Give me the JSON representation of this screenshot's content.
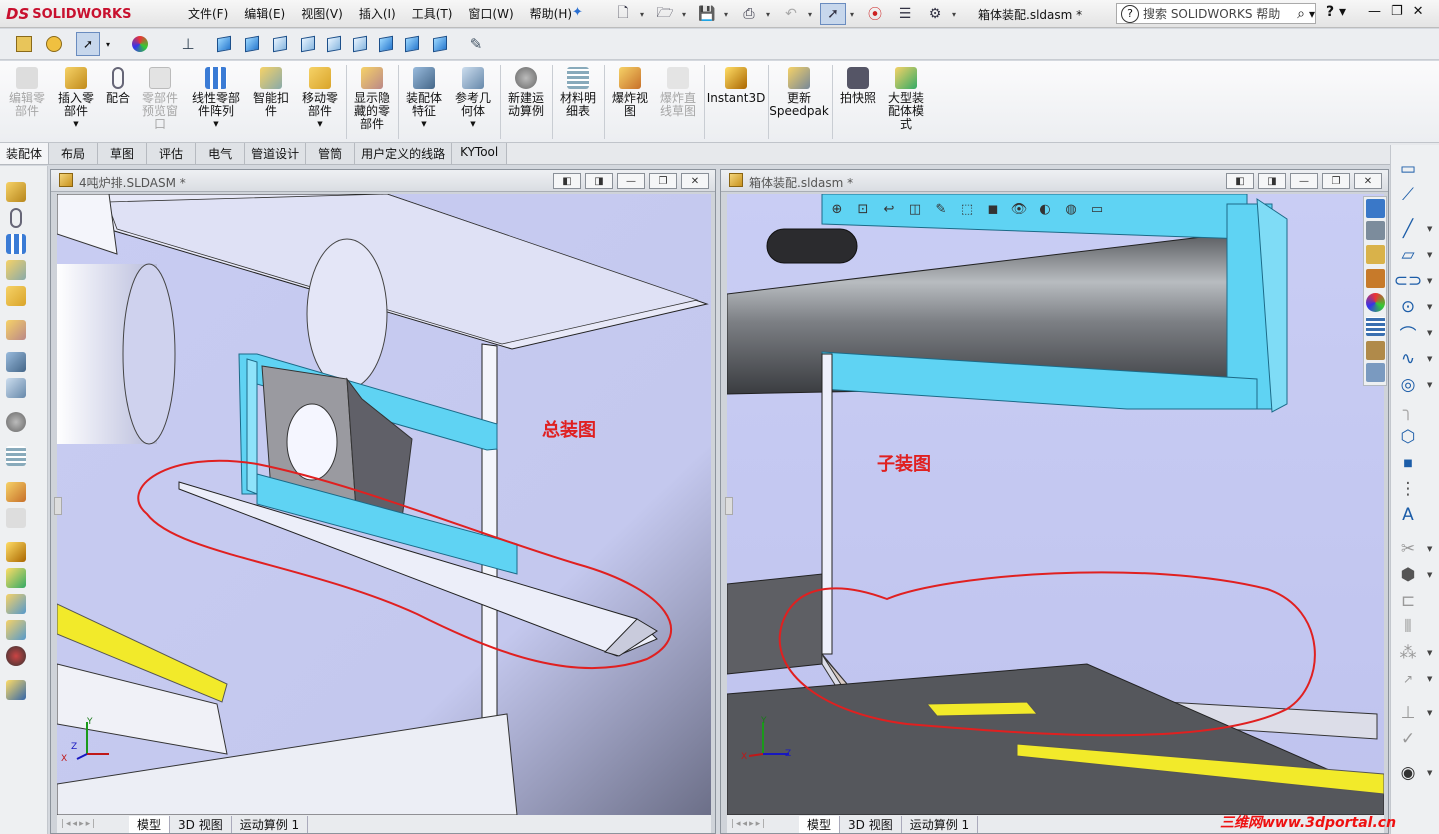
{
  "app": {
    "logo_prefix": "DS",
    "logo_name": "SOLIDWORKS"
  },
  "menu": [
    "文件(F)",
    "编辑(E)",
    "视图(V)",
    "插入(I)",
    "工具(T)",
    "窗口(W)",
    "帮助(H)"
  ],
  "document_title": "箱体装配.sldasm *",
  "search": {
    "placeholder": "搜索 SOLIDWORKS 帮助"
  },
  "command_manager": {
    "items": [
      {
        "label": "编辑零\n部件",
        "enabled": false
      },
      {
        "label": "插入零\n部件",
        "enabled": true
      },
      {
        "label": "配合",
        "enabled": true
      },
      {
        "label": "零部件\n预览窗\n口",
        "enabled": false
      },
      {
        "label": "线性零部\n件阵列",
        "enabled": true
      },
      {
        "label": "智能扣\n件",
        "enabled": true
      },
      {
        "label": "移动零\n部件",
        "enabled": true
      },
      {
        "label": "显示隐\n藏的零\n部件",
        "enabled": true
      },
      {
        "label": "装配体\n特征",
        "enabled": true
      },
      {
        "label": "参考几\n何体",
        "enabled": true
      },
      {
        "label": "新建运\n动算例",
        "enabled": true
      },
      {
        "label": "材料明\n细表",
        "enabled": true
      },
      {
        "label": "爆炸视\n图",
        "enabled": true
      },
      {
        "label": "爆炸直\n线草图",
        "enabled": false
      },
      {
        "label": "Instant3D",
        "enabled": true
      },
      {
        "label": "更新\nSpeedpak",
        "enabled": true
      },
      {
        "label": "拍快照",
        "enabled": true
      },
      {
        "label": "大型装\n配体模\n式",
        "enabled": true
      }
    ]
  },
  "tabs": [
    "装配体",
    "布局",
    "草图",
    "评估",
    "电气",
    "管道设计",
    "管筒",
    "用户定义的线路",
    "KYTool"
  ],
  "windows": {
    "left": {
      "title": "4吨炉排.SLDASM *",
      "annotation": "总装图",
      "bottom_tabs": [
        "模型",
        "3D 视图",
        "运动算例 1"
      ],
      "axes": {
        "x": "X",
        "y": "Y",
        "z": "Z"
      }
    },
    "right": {
      "title": "箱体装配.sldasm *",
      "annotation": "子装图",
      "bottom_tabs": [
        "模型",
        "3D 视图",
        "运动算例 1"
      ],
      "axes": {
        "x": "X",
        "y": "Y",
        "z": "Z"
      }
    }
  },
  "watermark": "三维网www.3dportal.cn",
  "colors": {
    "accent_red": "#e02020",
    "part_cyan": "#5fd3f3",
    "part_yellow": "#f2ea2a",
    "viewport_lavender": "#c9cdf4"
  }
}
